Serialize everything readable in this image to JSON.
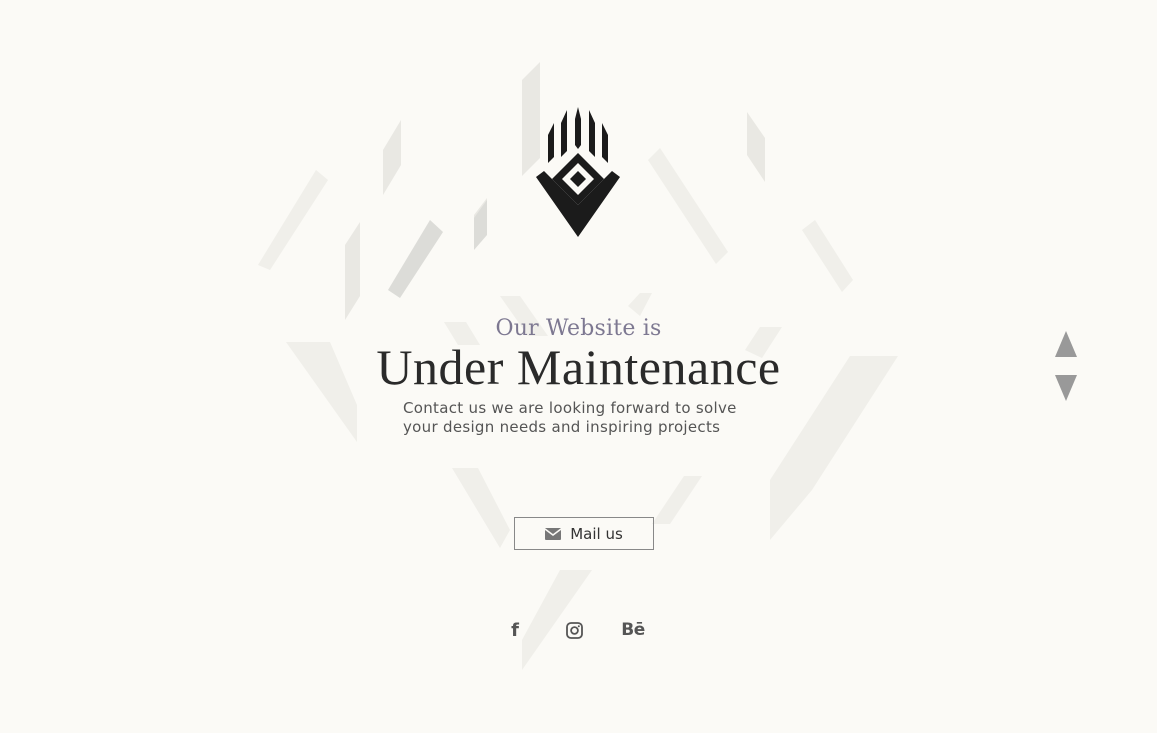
{
  "hero": {
    "subtitle": "Our Website is",
    "title": "Under Maintenance",
    "description_line1": "Contact us we are looking forward to solve",
    "description_line2": "your design needs and inspiring projects"
  },
  "actions": {
    "mail_label": "Mail us"
  },
  "social": {
    "facebook_glyph": "f",
    "behance_glyph": "Bē"
  },
  "icons": {
    "logo": "tribal-diamond-logo-icon",
    "mail": "envelope-icon",
    "facebook": "facebook-icon",
    "instagram": "instagram-icon",
    "behance": "behance-icon",
    "scroll_up": "triangle-up-icon",
    "scroll_down": "triangle-down-icon"
  },
  "colors": {
    "background": "#fbfaf6",
    "title": "#2a2a2a",
    "subtitle": "#7d7891",
    "text": "#555555",
    "arrows": "#999999"
  }
}
